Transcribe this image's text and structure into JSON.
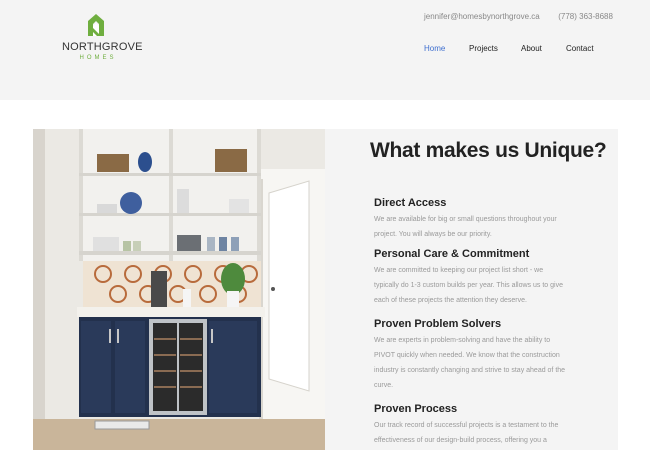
{
  "brand": {
    "name_bold": "NORTH",
    "name_light": "GROVE",
    "sub": "HOMES",
    "accent_color": "#6fae3f"
  },
  "contact": {
    "email": "jennifer@homesbynorthgrove.ca",
    "phone": "(778) 363-8688"
  },
  "nav": {
    "items": [
      "Home",
      "Projects",
      "About",
      "Contact"
    ],
    "active": "Home",
    "active_color": "#3f6fcf"
  },
  "section": {
    "title": "What makes us Unique?",
    "items": [
      {
        "heading": "Direct Access",
        "lines": [
          "We are available for big or small questions throughout your",
          "project. You will always be our priority."
        ]
      },
      {
        "heading": "Personal Care & Commitment",
        "lines": [
          "We are committed to keeping our project list short - we",
          "typically do 1-3 custom builds per year. This allows us to give",
          "each of these projects the attention they deserve."
        ]
      },
      {
        "heading": "Proven Problem Solvers",
        "lines": [
          "We are experts in problem-solving and have the ability to",
          "PIVOT quickly when needed. We know that the construction",
          "industry is constantly changing and strive to stay ahead of the",
          "curve."
        ]
      },
      {
        "heading": "Proven Process",
        "lines": [
          "Our track record of successful projects is a testament to the",
          "effectiveness of our design-build process, offering you a"
        ]
      }
    ]
  }
}
